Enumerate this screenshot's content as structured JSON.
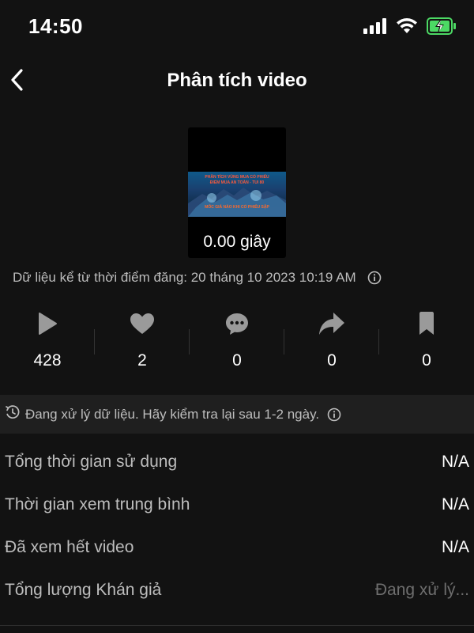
{
  "status_bar": {
    "time": "14:50",
    "icons": [
      "signal-icon",
      "wifi-icon",
      "battery-charging-icon"
    ],
    "battery_color": "#4cd964"
  },
  "header": {
    "title": "Phân tích video",
    "back_icon": "chevron-left-icon"
  },
  "video": {
    "thumbnail_caption_lines": [
      "PHÂN TÍCH VÙNG MUA CỔ PHIẾU",
      "ĐIỂM MUA AN TOÀN - TUI 80",
      "MỐC GIÁ NÀO KHI CỔ PHIẾU SẬP"
    ],
    "duration": "0.00 giây"
  },
  "data_since": {
    "text": "Dữ liệu kể từ thời điểm đăng: 20 tháng 10 2023 10:19 AM",
    "icon": "info-icon"
  },
  "stats": [
    {
      "name": "plays",
      "icon": "play-icon",
      "value": "428"
    },
    {
      "name": "likes",
      "icon": "heart-icon",
      "value": "2"
    },
    {
      "name": "comments",
      "icon": "comment-icon",
      "value": "0"
    },
    {
      "name": "shares",
      "icon": "share-icon",
      "value": "0"
    },
    {
      "name": "saves",
      "icon": "bookmark-icon",
      "value": "0"
    }
  ],
  "notice": {
    "text": "Đang xử lý dữ liệu. Hãy kiểm tra lại sau 1-2 ngày.",
    "icon": "clock-refresh-icon",
    "info_icon": "info-icon"
  },
  "metrics": [
    {
      "label": "Tổng thời gian sử dụng",
      "value": "N/A"
    },
    {
      "label": "Thời gian xem trung bình",
      "value": "N/A"
    },
    {
      "label": "Đã xem hết video",
      "value": "N/A"
    },
    {
      "label": "Tổng lượng Khán giả",
      "value": "Đang xử lý..."
    }
  ],
  "colors": {
    "background": "#121212",
    "notice_background": "#1f1f1f",
    "muted_text": "#bdbdbd",
    "icon_gray": "#9a9a9a"
  }
}
